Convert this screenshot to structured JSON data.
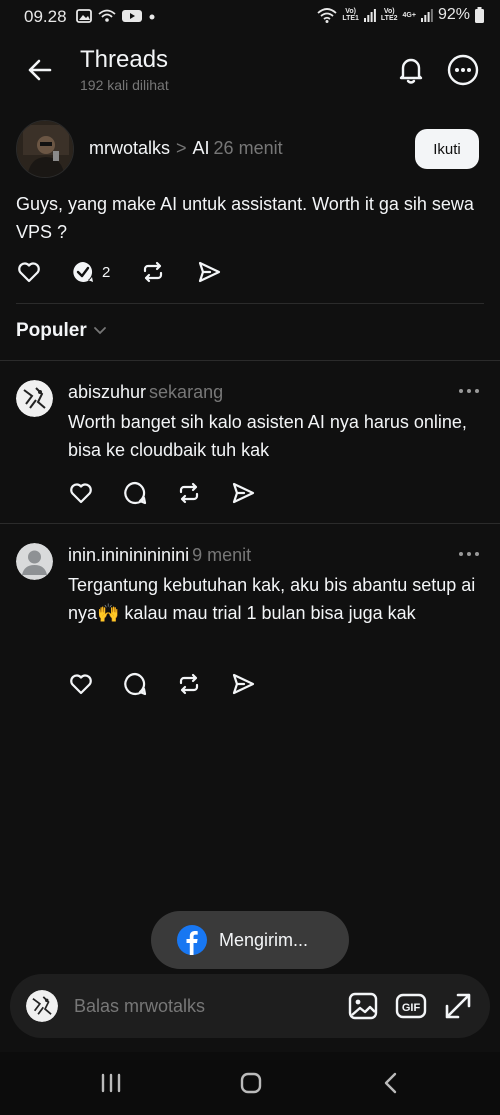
{
  "status_bar": {
    "time": "09.28",
    "battery": "92%",
    "net1": "Vo)\nLTE1",
    "net2": "Vo)\nLTE2",
    "net2_type": "4G+"
  },
  "header": {
    "title": "Threads",
    "views": "192 kali dilihat"
  },
  "post": {
    "username": "mrwotalks",
    "separator": ">",
    "topic": "AI",
    "time": "26 menit",
    "follow_label": "Ikuti",
    "text": "Guys, yang make AI untuk assistant. Worth it ga sih sewa VPS ?",
    "reply_count": "2"
  },
  "sort": {
    "label": "Populer"
  },
  "replies": [
    {
      "username": "abiszuhur",
      "time": "sekarang",
      "text": "Worth banget sih kalo asisten AI nya harus online, bisa ke cloudbaik tuh kak"
    },
    {
      "username": "inin.inininininini",
      "time": "9 menit",
      "text": "Tergantung kebutuhan kak, aku bis abantu setup ai nya🙌 kalau mau trial 1 bulan bisa juga kak"
    }
  ],
  "toast": {
    "text": "Mengirim..."
  },
  "reply_bar": {
    "placeholder": "Balas mrwotalks",
    "gif_label": "GIF"
  },
  "colors": {
    "background": "#101010",
    "text": "#f3f5f7",
    "muted": "#777777",
    "facebook": "#1877f2"
  }
}
